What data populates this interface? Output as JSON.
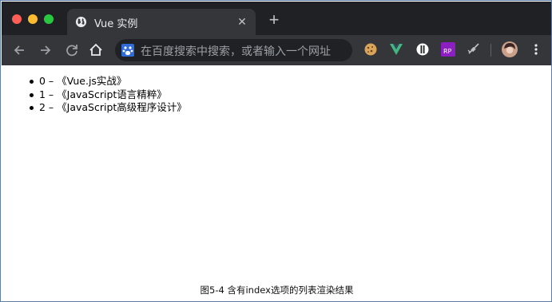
{
  "window": {
    "tab_title": "Vue 实例",
    "tab_close": "✕",
    "new_tab": "+"
  },
  "toolbar": {
    "back_icon": "back-arrow-icon",
    "forward_icon": "forward-arrow-icon",
    "reload_icon": "reload-icon",
    "home_icon": "home-icon",
    "omnibox_placeholder": "在百度搜索中搜索，或者输入一个网址",
    "extensions": [
      "cookie-extension-icon",
      "vue-devtools-icon",
      "ublock-icon",
      "rp-extension-icon",
      "satellite-extension-icon"
    ],
    "menu_icon": "more-vert-icon"
  },
  "page": {
    "items": [
      "0 – 《Vue.js实战》",
      "1 – 《JavaScript语言精粹》",
      "2 – 《JavaScript高级程序设计》"
    ]
  },
  "caption": "图5-4  含有index选项的列表渲染结果",
  "colors": {
    "titlebar": "#202124",
    "toolbar": "#35363a",
    "vue_green": "#41b883",
    "frame_border": "#5f7fa8"
  }
}
